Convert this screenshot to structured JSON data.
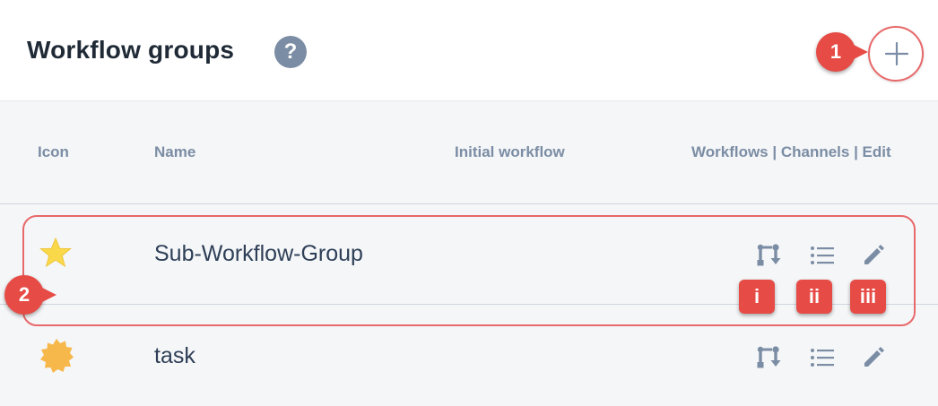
{
  "header": {
    "title": "Workflow groups",
    "help_icon": "question-circle-icon",
    "add_icon": "plus-icon"
  },
  "columns": {
    "icon": "Icon",
    "name": "Name",
    "initial_workflow": "Initial workflow",
    "actions": "Workflows | Channels | Edit"
  },
  "rows": [
    {
      "icon": "star-icon",
      "icon_color": "#f9d94a",
      "name": "Sub-Workflow-Group",
      "initial_workflow": ""
    },
    {
      "icon": "badge-burst-icon",
      "icon_color": "#f7b84b",
      "name": "task",
      "initial_workflow": ""
    }
  ],
  "action_icons": [
    "workflow-branch-icon",
    "list-icon",
    "pencil-icon"
  ],
  "annotations": {
    "callout_1": "1",
    "callout_2": "2",
    "callout_i": "i",
    "callout_ii": "ii",
    "callout_iii": "iii"
  },
  "colors": {
    "callout": "#e64b45",
    "highlight_border": "#e8686a",
    "help_icon": "#7b8da4",
    "action_icon": "#7b8da4",
    "title": "#1f2a36"
  }
}
